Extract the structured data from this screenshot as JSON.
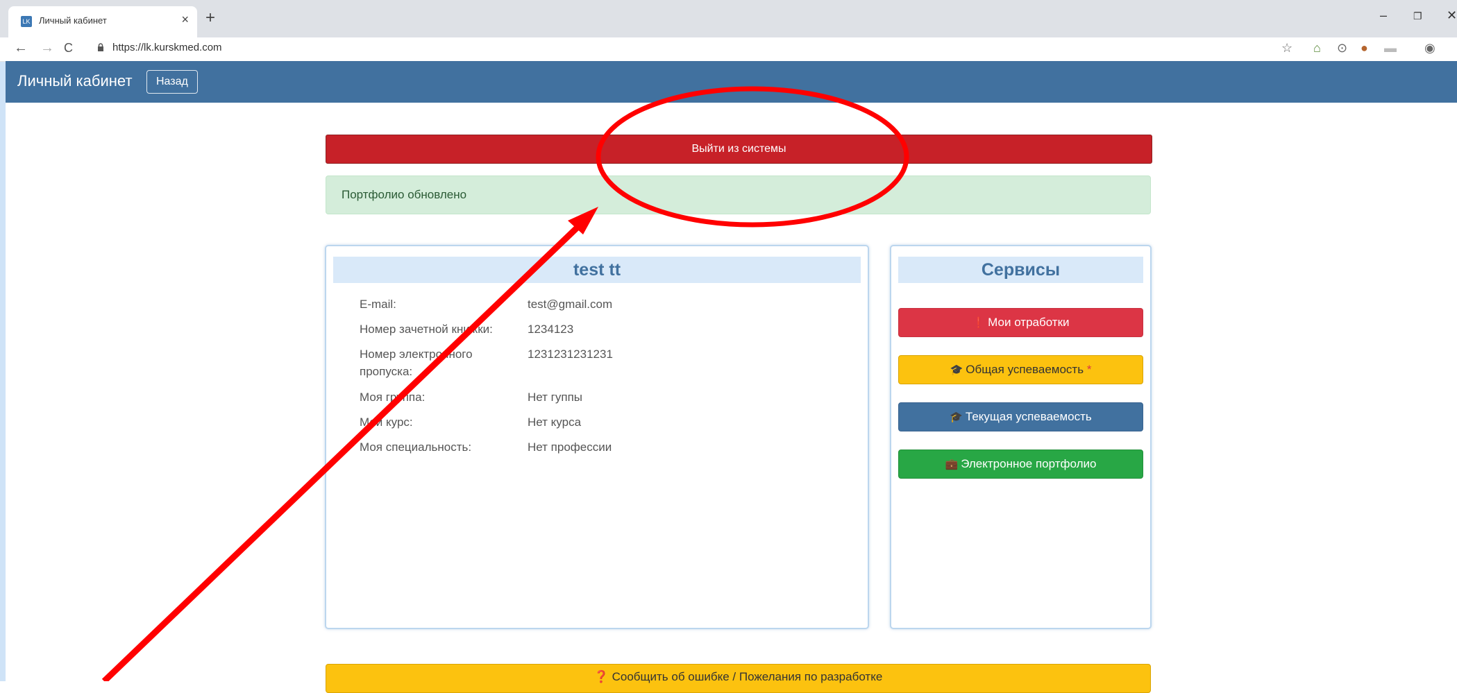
{
  "browser": {
    "tab_title": "Личный кабинет",
    "tab_favicon_text": "LK",
    "url": "https://lk.kurskmed.com"
  },
  "navbar": {
    "brand": "Личный кабинет",
    "back_label": "Назад",
    "color": "#41719f"
  },
  "logout_label": "Выйти из системы",
  "alert_text": "Портфолио обновлено",
  "profile": {
    "name": "test tt",
    "fields": [
      {
        "label": "E-mail:",
        "value": "test@gmail.com"
      },
      {
        "label": "Номер зачетной книжки:",
        "value": "1234123"
      },
      {
        "label": "Номер электронного пропуска:",
        "value": "1231231231231"
      },
      {
        "label": "Моя группа:",
        "value": "Нет гуппы"
      },
      {
        "label": "Мой курс:",
        "value": "Нет курса"
      },
      {
        "label": "Моя специальность:",
        "value": "Нет профессии"
      }
    ]
  },
  "services": {
    "title": "Сервисы",
    "items": [
      {
        "label": "Мои отработки",
        "icon": "exclamation-circle-icon",
        "color": "#dc3545"
      },
      {
        "label": "Общая успеваемость",
        "marker": "*",
        "icon": "graduation-cap-icon",
        "color": "#fcc20f"
      },
      {
        "label": "Текущая успеваемость",
        "icon": "graduation-cap-icon",
        "color": "#41719f"
      },
      {
        "label": "Электронное портфолио",
        "icon": "briefcase-icon",
        "color": "#28a745"
      }
    ]
  },
  "report_label": "Сообщить об ошибке / Пожелания по разработке",
  "annotation_color": "#ff0000"
}
